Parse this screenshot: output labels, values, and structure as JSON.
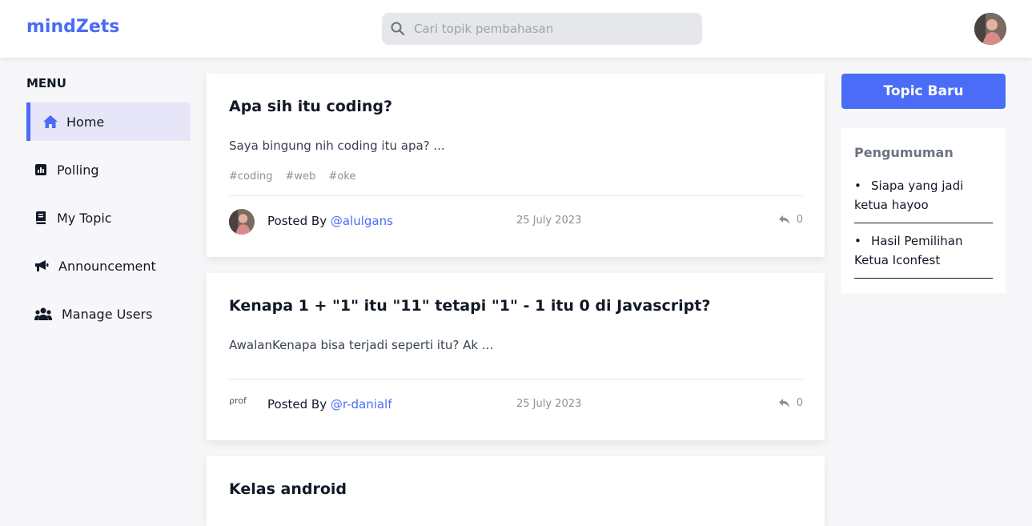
{
  "app": {
    "brand": "mindZets"
  },
  "search": {
    "placeholder": "Cari topik pembahasan"
  },
  "sidebar": {
    "title": "MENU",
    "items": [
      {
        "label": "Home",
        "icon": "home-icon",
        "active": true
      },
      {
        "label": "Polling",
        "icon": "chart-icon"
      },
      {
        "label": "My Topic",
        "icon": "book-icon"
      },
      {
        "label": "Announcement",
        "icon": "megaphone-icon"
      },
      {
        "label": "Manage Users",
        "icon": "users-icon"
      }
    ]
  },
  "posts": [
    {
      "title": "Apa sih itu coding?",
      "excerpt": "Saya bingung nih coding itu apa? ...",
      "tags": [
        "#coding",
        "#web",
        "#oke"
      ],
      "posted_by_label": "Posted By",
      "author": "@alulgans",
      "date": "25 July 2023",
      "replies": "0"
    },
    {
      "title": "Kenapa 1 + \"1\" itu \"11\" tetapi \"1\" - 1 itu 0 di Javascript?",
      "excerpt": "AwalanKenapa bisa terjadi seperti itu? Ak ...",
      "tags": [],
      "posted_by_label": "Posted By",
      "author": "@r-danialf",
      "avatar_alt": "prof",
      "date": "25 July 2023",
      "replies": "0"
    },
    {
      "title": "Kelas android"
    }
  ],
  "right": {
    "new_topic_label": "Topic Baru",
    "announcement_title": "Pengumuman",
    "announcements": [
      "Siapa yang jadi ketua hayoo",
      "Hasil Pemilihan Ketua Iconfest"
    ]
  },
  "colors": {
    "accent": "#4a6cf7",
    "active_bg": "#e7e6f8",
    "muted": "#8b8f97"
  }
}
